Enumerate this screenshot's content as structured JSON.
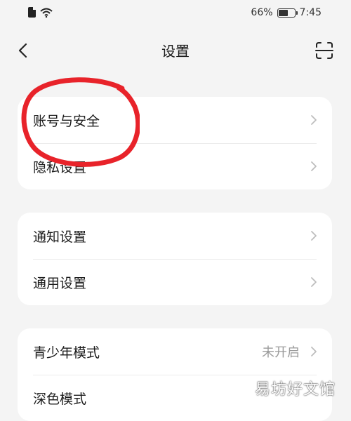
{
  "status_bar": {
    "battery_percent": "66%",
    "battery_level": 0.66,
    "time": "7:45",
    "left_icons": [
      "sim-icon",
      "wifi-icon"
    ]
  },
  "header": {
    "title": "设置",
    "back_icon": "chevron-left-icon",
    "scan_icon": "scan-icon"
  },
  "groups": [
    {
      "items": [
        {
          "label": "账号与安全",
          "highlighted": true
        },
        {
          "label": "隐私设置"
        }
      ]
    },
    {
      "items": [
        {
          "label": "通知设置"
        },
        {
          "label": "通用设置"
        }
      ]
    },
    {
      "items": [
        {
          "label": "青少年模式",
          "value": "未开启"
        },
        {
          "label": "深色模式"
        }
      ]
    }
  ],
  "colors": {
    "background": "#f4f4f4",
    "card": "#ffffff",
    "highlight_circle": "#e8232a",
    "secondary_text": "#9a9a9a"
  },
  "watermark": "易坊好文馆"
}
